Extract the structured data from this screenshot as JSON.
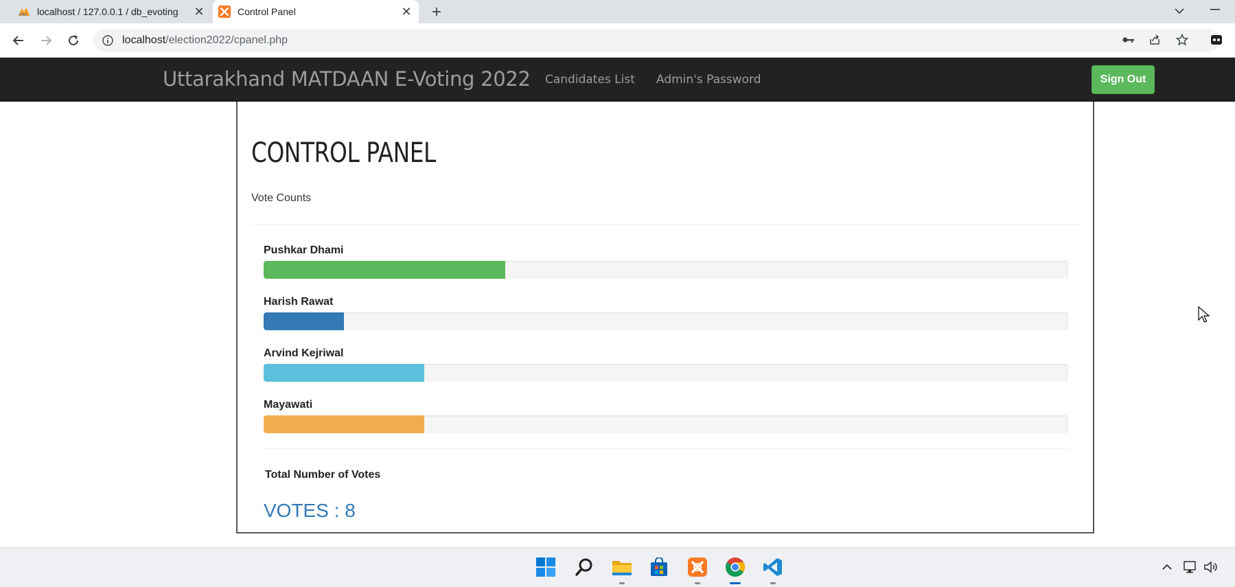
{
  "browser": {
    "tabs": [
      {
        "title": "localhost / 127.0.0.1 / db_evoting",
        "active": false
      },
      {
        "title": "Control Panel",
        "active": true
      }
    ],
    "url_host": "localhost",
    "url_path": "/election2022/cpanel.php"
  },
  "navbar": {
    "brand": "Uttarakhand MATDAAN E-Voting 2022",
    "links": [
      "Candidates List",
      "Admin's Password"
    ],
    "signout_label": "Sign Out"
  },
  "panel": {
    "title": "CONTROL PANEL",
    "subtitle": "Vote Counts",
    "candidates": [
      {
        "name": "Pushkar Dhami",
        "votes_fraction": 0.3,
        "color": "#5cb85c"
      },
      {
        "name": "Harish Rawat",
        "votes_fraction": 0.1,
        "color": "#337ab7"
      },
      {
        "name": "Arvind Kejriwal",
        "votes_fraction": 0.2,
        "color": "#5bc0de"
      },
      {
        "name": "Mayawati",
        "votes_fraction": 0.2,
        "color": "#f0ad4e"
      }
    ],
    "total_label": "Total Number of Votes",
    "votes_text": "VOTES : 8"
  },
  "taskbar": {
    "icons": [
      "windows-start-icon",
      "search-icon",
      "file-explorer-icon",
      "microsoft-store-icon",
      "xampp-icon",
      "chrome-icon",
      "vscode-icon"
    ]
  }
}
